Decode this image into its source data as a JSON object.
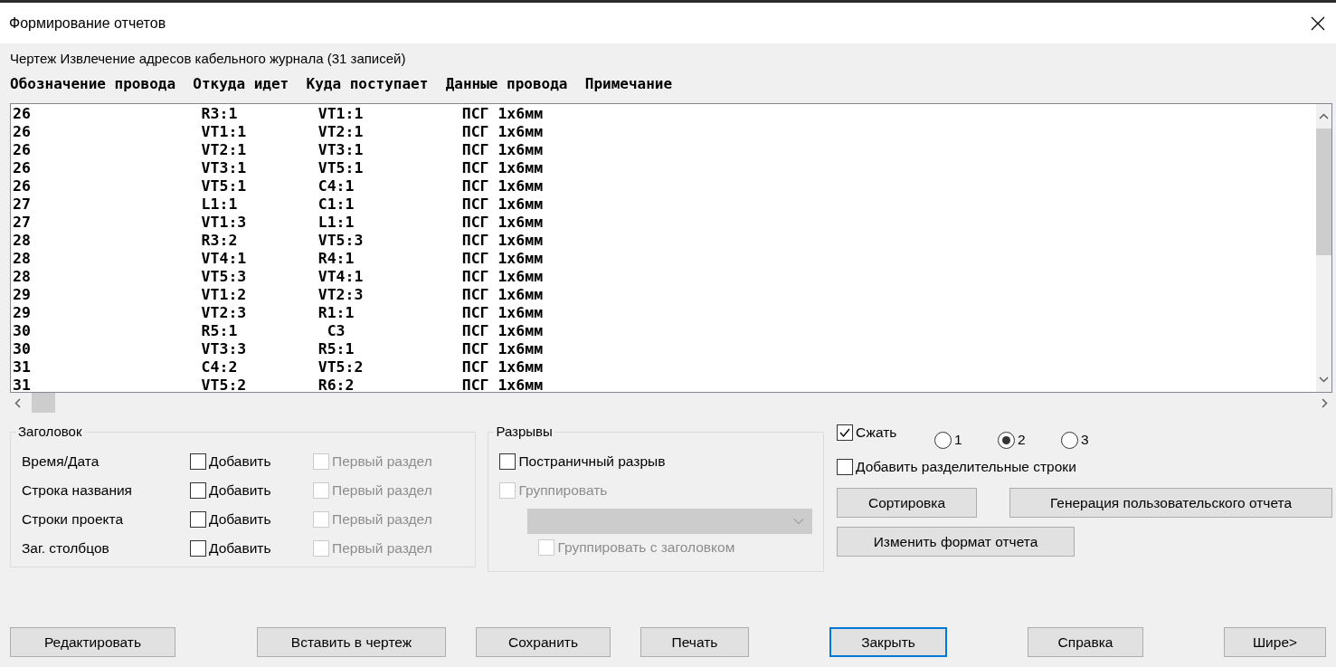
{
  "window": {
    "title": "Формирование отчетов"
  },
  "report_title": "Чертеж Извлечение адресов кабельного журнала (31 записей)",
  "columns": [
    "Обозначение провода",
    "Откуда идет",
    "Куда поступает",
    "Данные провода",
    "Примечание"
  ],
  "rows": [
    "26                   R3:1         VT1:1           ПСГ 1х6мм",
    "26                   VT1:1        VT2:1           ПСГ 1х6мм",
    "26                   VT2:1        VT3:1           ПСГ 1х6мм",
    "26                   VT3:1        VT5:1           ПСГ 1х6мм",
    "26                   VT5:1        C4:1            ПСГ 1х6мм",
    "27                   L1:1         C1:1            ПСГ 1х6мм",
    "27                   VT1:3        L1:1            ПСГ 1х6мм",
    "28                   R3:2         VT5:3           ПСГ 1х6мм",
    "28                   VT4:1        R4:1            ПСГ 1х6мм",
    "28                   VT5:3        VT4:1           ПСГ 1х6мм",
    "29                   VT1:2        VT2:3           ПСГ 1х6мм",
    "29                   VT2:3        R1:1            ПСГ 1х6мм",
    "30                   R5:1          C3             ПСГ 1х6мм",
    "30                   VT3:3        R5:1            ПСГ 1х6мм",
    "31                   C4:2         VT5:2           ПСГ 1х6мм",
    "31                   VT5:2        R6:2            ПСГ 1х6мм"
  ],
  "header_group": {
    "title": "Заголовок",
    "rows": [
      {
        "label": "Время/Дата",
        "add": {
          "label": "Добавить",
          "checked": false
        },
        "first_section": {
          "label": "Первый раздел",
          "checked": false,
          "disabled": true
        }
      },
      {
        "label": "Строка названия",
        "add": {
          "label": "Добавить",
          "checked": false
        },
        "first_section": {
          "label": "Первый раздел",
          "checked": false,
          "disabled": true
        }
      },
      {
        "label": "Строки проекта",
        "add": {
          "label": "Добавить",
          "checked": false
        },
        "first_section": {
          "label": "Первый раздел",
          "checked": false,
          "disabled": true
        }
      },
      {
        "label": "Заг. столбцов",
        "add": {
          "label": "Добавить",
          "checked": false
        },
        "first_section": {
          "label": "Первый раздел",
          "checked": false,
          "disabled": true
        }
      }
    ]
  },
  "breaks_group": {
    "title": "Разрывы",
    "page_break": {
      "label": "Постраничный разрыв",
      "checked": false,
      "disabled": false
    },
    "group": {
      "label": "Группировать",
      "checked": false,
      "disabled": true
    },
    "group_select": {
      "disabled": true
    },
    "group_with_header": {
      "label": "Группировать с заголовком",
      "checked": false,
      "disabled": true
    }
  },
  "compress": {
    "label": "Сжать",
    "checked": true
  },
  "compress_levels": [
    {
      "label": "1",
      "selected": false
    },
    {
      "label": "2",
      "selected": true
    },
    {
      "label": "3",
      "selected": false
    }
  ],
  "separator_lines": {
    "label": "Добавить разделительные строки",
    "checked": false
  },
  "sort_button": "Сортировка",
  "custom_report_button": "Генерация пользовательского отчета",
  "format_button": "Изменить формат отчета",
  "bottom_buttons": [
    {
      "label": "Редактировать",
      "focused": false
    },
    {
      "label": "Вставить в чертеж",
      "focused": false
    },
    {
      "label": "Сохранить",
      "focused": false
    },
    {
      "label": "Печать",
      "focused": false
    },
    {
      "label": "Закрыть",
      "focused": true
    },
    {
      "label": "Справка",
      "focused": false
    },
    {
      "label": "Шире>",
      "focused": false
    }
  ]
}
